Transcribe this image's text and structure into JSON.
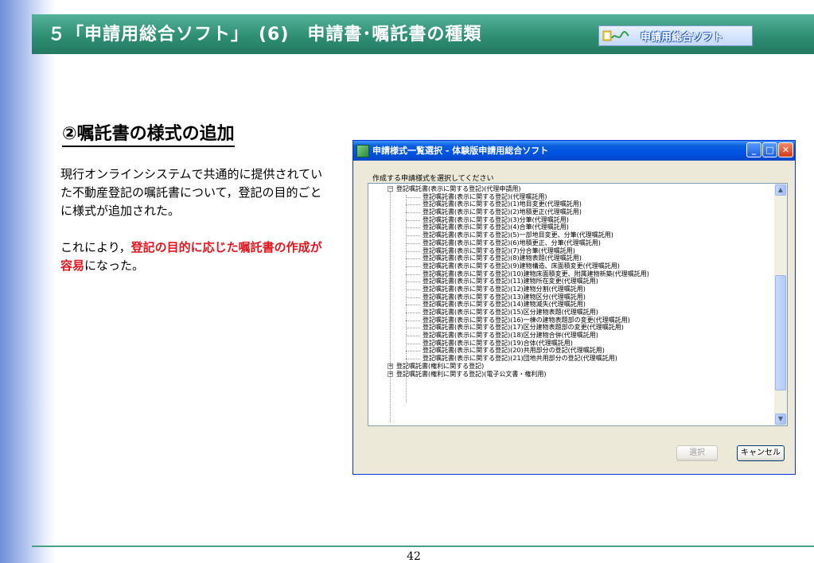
{
  "header": {
    "title": "５「申請用総合ソフト」　(6)　申請書･嘱託書の種類",
    "logo_text": "申請用総合ソフト"
  },
  "content": {
    "heading": "②嘱託書の様式の追加",
    "paragraph1": "現行オンラインシステムで共通的に提供されていた不動産登記の嘱託書について，登記の目的ごとに様式が追加された。",
    "paragraph2_prefix": "これにより，",
    "paragraph2_highlight": "登記の目的に応じた嘱託書の作成が容易",
    "paragraph2_suffix": "になった。"
  },
  "dialog": {
    "title": "申請様式一覧選択 - 体験版申請用総合ソフト",
    "prompt": "作成する申請様式を選択してください",
    "tree": [
      {
        "type": "expanded",
        "label": "登記嘱託書(表示に関する登記)(代理申請用)"
      },
      {
        "type": "child",
        "label": "登記嘱託書(表示に関する登記)(代理嘱託用)"
      },
      {
        "type": "child",
        "label": "登記嘱託書(表示に関する登記)(1)地目変更(代理嘱託用)"
      },
      {
        "type": "child",
        "label": "登記嘱託書(表示に関する登記)(2)地積更正(代理嘱託用)"
      },
      {
        "type": "child",
        "label": "登記嘱託書(表示に関する登記)(3)分筆(代理嘱託用)"
      },
      {
        "type": "child",
        "label": "登記嘱託書(表示に関する登記)(4)合筆(代理嘱託用)"
      },
      {
        "type": "child",
        "label": "登記嘱託書(表示に関する登記)(5)一部地目変更、分筆(代理嘱託用)"
      },
      {
        "type": "child",
        "label": "登記嘱託書(表示に関する登記)(6)地積更正、分筆(代理嘱託用)"
      },
      {
        "type": "child",
        "label": "登記嘱託書(表示に関する登記)(7)分合筆(代理嘱託用)"
      },
      {
        "type": "child",
        "label": "登記嘱託書(表示に関する登記)(8)建物表題(代理嘱託用)"
      },
      {
        "type": "child",
        "label": "登記嘱託書(表示に関する登記)(9)建物構造、床面積変更(代理嘱託用)"
      },
      {
        "type": "child",
        "label": "登記嘱託書(表示に関する登記)(10)建物床面積変更、附属建物新築(代理嘱託用)"
      },
      {
        "type": "child",
        "label": "登記嘱託書(表示に関する登記)(11)建物所在変更(代理嘱託用)"
      },
      {
        "type": "child",
        "label": "登記嘱託書(表示に関する登記)(12)建物分割(代理嘱託用)"
      },
      {
        "type": "child",
        "label": "登記嘱託書(表示に関する登記)(13)建物区分(代理嘱託用)"
      },
      {
        "type": "child",
        "label": "登記嘱託書(表示に関する登記)(14)建物滅失(代理嘱託用)"
      },
      {
        "type": "child",
        "label": "登記嘱託書(表示に関する登記)(15)区分建物表題(代理嘱託用)"
      },
      {
        "type": "child",
        "label": "登記嘱託書(表示に関する登記)(16)一棟の建物表題部の変更(代理嘱託用)"
      },
      {
        "type": "child",
        "label": "登記嘱託書(表示に関する登記)(17)区分建物表題部の変更(代理嘱託用)"
      },
      {
        "type": "child",
        "label": "登記嘱託書(表示に関する登記)(18)区分建物合併(代理嘱託用)"
      },
      {
        "type": "child",
        "label": "登記嘱託書(表示に関する登記)(19)合体(代理嘱託用)"
      },
      {
        "type": "child",
        "label": "登記嘱託書(表示に関する登記)(20)共用部分の登記(代理嘱託用)"
      },
      {
        "type": "child",
        "label": "登記嘱託書(表示に関する登記)(21)団地共用部分の登記(代理嘱託用)"
      },
      {
        "type": "collapsed",
        "label": "登記嘱託書(権利に関する登記)"
      },
      {
        "type": "collapsed",
        "label": "登記嘱託書(権利に関する登記)(電子公文書・権利用)"
      }
    ],
    "select_label": "選択",
    "cancel_label": "キャンセル"
  },
  "footer": {
    "page_number": "42"
  },
  "colors": {
    "header_green": "#2f8f73",
    "highlight_red": "#e0161e",
    "titlebar_blue": "#0254e3"
  }
}
